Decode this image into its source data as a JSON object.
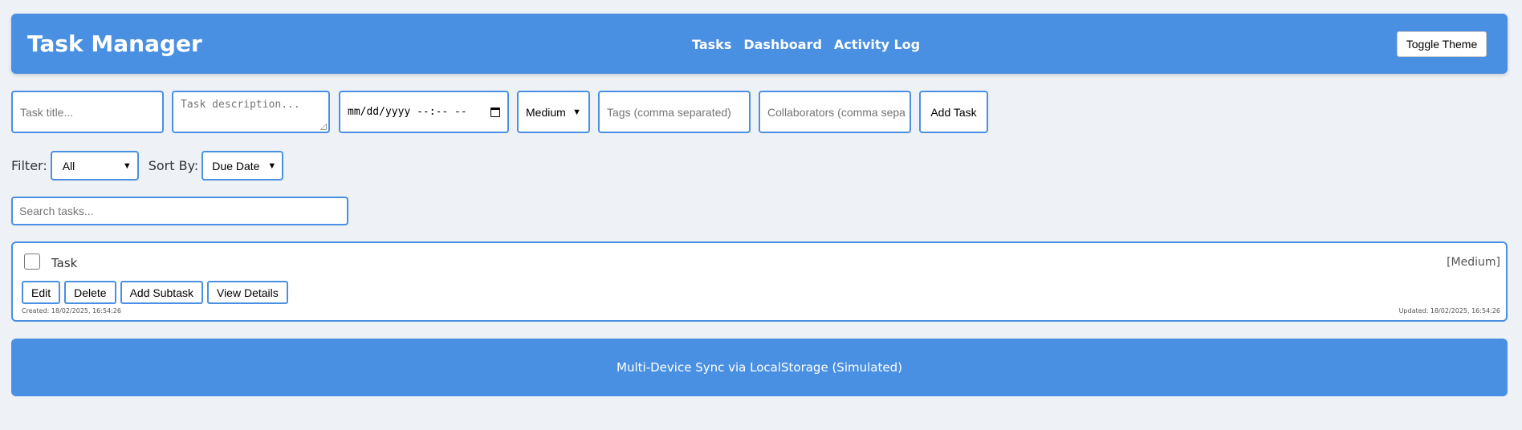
{
  "header": {
    "title": "Task Manager",
    "nav": [
      "Tasks",
      "Dashboard",
      "Activity Log"
    ],
    "toggle_theme_label": "Toggle Theme"
  },
  "form": {
    "title_placeholder": "Task title...",
    "description_placeholder": "Task description...",
    "date_placeholder": "mm/dd/yyyy --:-- --",
    "priority_value": "Medium",
    "tags_placeholder": "Tags (comma separated)",
    "collaborators_placeholder": "Collaborators (comma sepa",
    "add_task_label": "Add Task"
  },
  "filters": {
    "filter_label": "Filter:",
    "filter_value": "All",
    "sort_label": "Sort By:",
    "sort_value": "Due Date"
  },
  "search": {
    "placeholder": "Search tasks..."
  },
  "tasks": [
    {
      "title": "Task",
      "priority": "[Medium]",
      "completed": false,
      "actions": [
        "Edit",
        "Delete",
        "Add Subtask",
        "View Details"
      ],
      "created": "Created: 18/02/2025, 16:54:26",
      "updated": "Updated: 18/02/2025, 16:54:26"
    }
  ],
  "footer": {
    "text": "Multi-Device Sync via LocalStorage (Simulated)"
  },
  "colors": {
    "accent": "#4a90e2",
    "background": "#eef2f7"
  },
  "icons": {
    "date_picker": "calendar-icon",
    "select": "chevron-down-icon"
  }
}
